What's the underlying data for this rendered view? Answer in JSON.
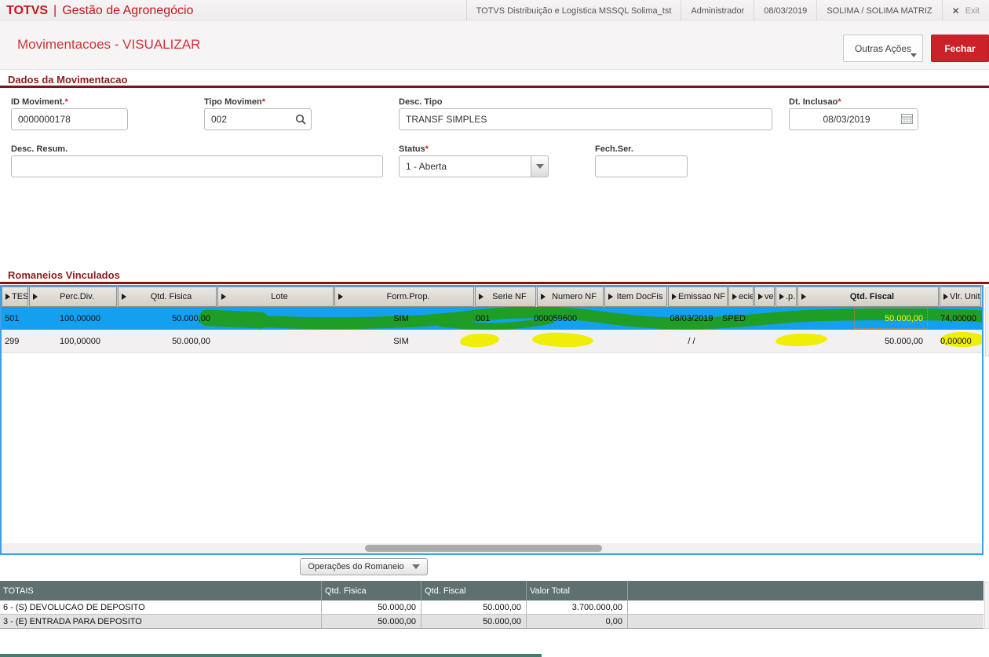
{
  "topbar": {
    "brand": "TOTVS",
    "separator": "|",
    "product": "Gestão de Agronegócio",
    "environment": "TOTVS Distribuição e Logística MSSQL Solima_tst",
    "user": "Administrador",
    "date": "08/03/2019",
    "company": "SOLIMA / SOLIMA MATRIZ",
    "exit_icon": "✕",
    "exit_label": "Exit"
  },
  "header": {
    "title": "Movimentacoes - VISUALIZAR",
    "outras_acoes_label": "Outras Ações",
    "fechar_label": "Fechar"
  },
  "form": {
    "section_title": "Dados da Movimentacao",
    "required_marker": "*",
    "fields": {
      "id_moviment": {
        "label": "ID Moviment.",
        "value": "0000000178",
        "required": true
      },
      "tipo_movimen": {
        "label": "Tipo Movimen",
        "value": "002",
        "required": true
      },
      "desc_tipo": {
        "label": "Desc. Tipo",
        "value": "TRANSF SIMPLES",
        "required": false
      },
      "dt_inclusao": {
        "label": "Dt. Inclusao",
        "value": "08/03/2019",
        "required": true
      },
      "desc_resum": {
        "label": "Desc. Resum.",
        "value": "",
        "required": false
      },
      "status": {
        "label": "Status",
        "value": "1 - Aberta",
        "required": true
      },
      "fech_ser": {
        "label": "Fech.Ser.",
        "value": "",
        "required": false
      }
    }
  },
  "romaneios": {
    "section_title": "Romaneios Vinculados",
    "operacoes_label": "Operações do Romaneio",
    "columns": [
      {
        "label": "TES"
      },
      {
        "label": "Perc.Div."
      },
      {
        "label": "Qtd. Fisica"
      },
      {
        "label": "Lote"
      },
      {
        "label": "Form.Prop."
      },
      {
        "label": "Serie NF"
      },
      {
        "label": "Numero NF"
      },
      {
        "label": "Item DocFis"
      },
      {
        "label": "Emissao NF"
      },
      {
        "label": "ecie"
      },
      {
        "label": "ve"
      },
      {
        "label": ".p."
      },
      {
        "label": "Qtd. Fiscal"
      },
      {
        "label": "Vlr. Unit"
      }
    ],
    "rows": [
      {
        "cells": [
          "501",
          "100,00000",
          "50.000,00",
          "",
          "SIM",
          "001",
          "000059600",
          "",
          "08/03/2019",
          "SPED",
          "",
          "",
          "50.000,00",
          "74,00000"
        ]
      },
      {
        "cells": [
          "299",
          "100,00000",
          "50.000,00",
          "",
          "SIM",
          "",
          "",
          "",
          "/ /",
          "",
          "",
          "",
          "50.000,00",
          "0,00000"
        ]
      }
    ]
  },
  "totais": {
    "headers": [
      "TOTAIS",
      "Qtd. Fisica",
      "Qtd. Fiscal",
      "Valor Total"
    ],
    "rows": [
      {
        "cells": [
          "6 - (S) DEVOLUCAO DE DEPOSITO",
          "50.000,00",
          "50.000,00",
          "3.700.000,00"
        ]
      },
      {
        "cells": [
          "3 - (E) ENTRADA PARA DEPOSITO",
          "50.000,00",
          "50.000,00",
          "0,00"
        ]
      }
    ]
  },
  "colors": {
    "brand_red": "#c2171d",
    "section_maroon": "#7e1517",
    "selected_row_blue": "#14a0ef",
    "marker_green": "#1f9e27",
    "marker_yellow": "#f0ee06",
    "focus_cell_text_yellow": "#fdfd00",
    "totals_header_slate": "#5e706f",
    "grid_border_blue": "#3da0ea"
  }
}
